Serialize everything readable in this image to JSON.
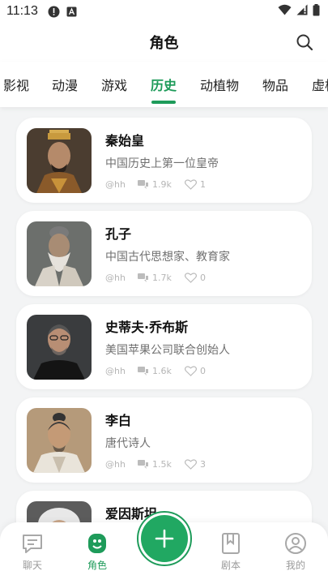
{
  "status_bar": {
    "time": "11:13"
  },
  "header": {
    "title": "角色"
  },
  "tabs": [
    "影视",
    "动漫",
    "游戏",
    "历史",
    "动植物",
    "物品",
    "虚构"
  ],
  "active_tab": "历史",
  "characters": [
    {
      "name": "秦始皇",
      "desc": "中国历史上第一位皇帝",
      "author": "@hh",
      "views": "1.9k",
      "likes": "1"
    },
    {
      "name": "孔子",
      "desc": "中国古代思想家、教育家",
      "author": "@hh",
      "views": "1.7k",
      "likes": "0"
    },
    {
      "name": "史蒂夫·乔布斯",
      "desc": "美国苹果公司联合创始人",
      "author": "@hh",
      "views": "1.6k",
      "likes": "0"
    },
    {
      "name": "李白",
      "desc": "唐代诗人",
      "author": "@hh",
      "views": "1.5k",
      "likes": "3"
    },
    {
      "name": "爱因斯坦",
      "desc": "",
      "author": "",
      "views": "",
      "likes": ""
    }
  ],
  "bottom_nav": {
    "chat": "聊天",
    "characters": "角色",
    "scripts": "剧本",
    "mine": "我的"
  },
  "colors": {
    "accent": "#1e9b5a",
    "fab": "#21a862"
  }
}
